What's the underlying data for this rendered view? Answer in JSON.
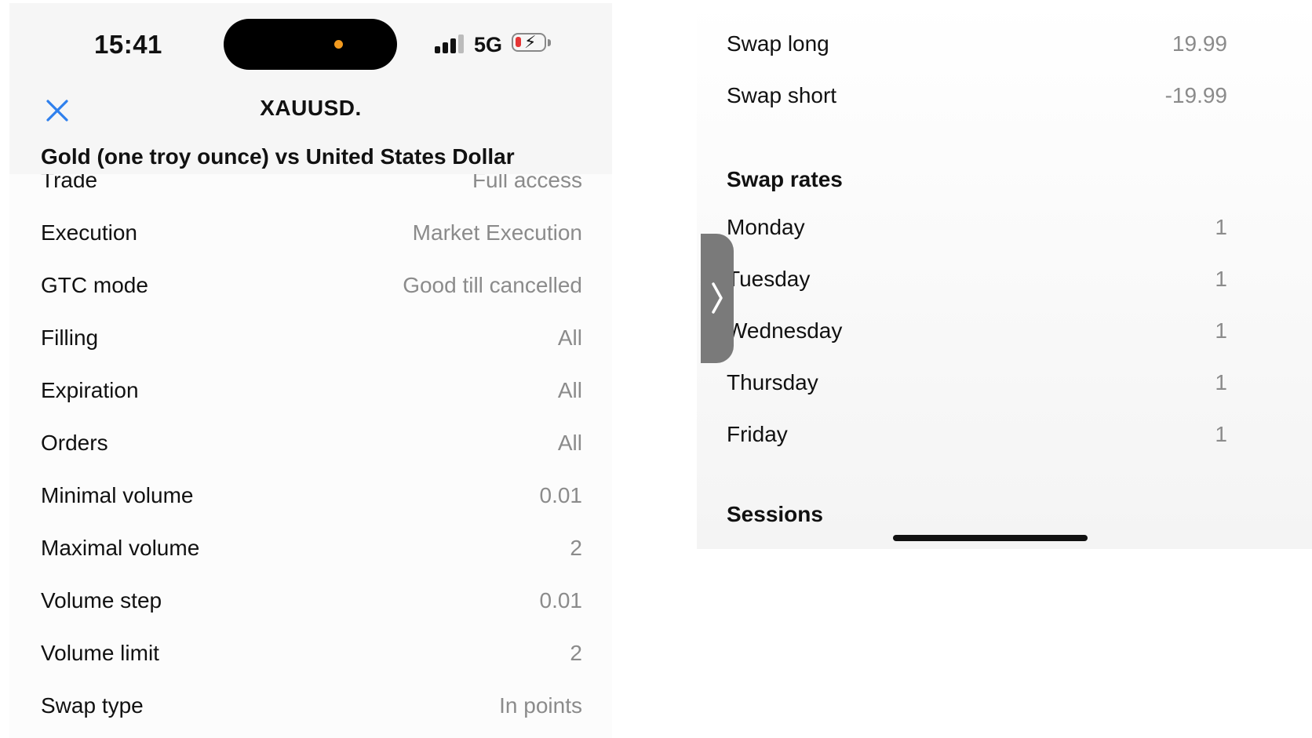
{
  "status_bar": {
    "time": "15:41",
    "network": "5G",
    "battery_level": 0.2,
    "battery_color": "#e53535",
    "charging": true
  },
  "nav": {
    "title": "XAUUSD.",
    "close_icon": "close-icon",
    "accent": "#2f80ed"
  },
  "symbol": {
    "description": "Gold (one troy ounce) vs United States Dollar"
  },
  "left_rows": [
    {
      "label": "Trade",
      "value": "Full access"
    },
    {
      "label": "Execution",
      "value": "Market Execution"
    },
    {
      "label": "GTC mode",
      "value": "Good till cancelled"
    },
    {
      "label": "Filling",
      "value": "All"
    },
    {
      "label": "Expiration",
      "value": "All"
    },
    {
      "label": "Orders",
      "value": "All"
    },
    {
      "label": "Minimal volume",
      "value": "0.01"
    },
    {
      "label": "Maximal volume",
      "value": "2"
    },
    {
      "label": "Volume step",
      "value": "0.01"
    },
    {
      "label": "Volume limit",
      "value": "2"
    },
    {
      "label": "Swap type",
      "value": "In points"
    }
  ],
  "swap": {
    "long_label": "Swap long",
    "long_value": "19.99",
    "short_label": "Swap short",
    "short_value": "-19.99"
  },
  "swap_rates": {
    "title": "Swap rates",
    "days": [
      {
        "label": "Monday",
        "value": "1"
      },
      {
        "label": "Tuesday",
        "value": "1"
      },
      {
        "label": "Wednesday",
        "value": "1"
      },
      {
        "label": "Thursday",
        "value": "1"
      },
      {
        "label": "Friday",
        "value": "1"
      }
    ]
  },
  "sessions": {
    "title": "Sessions"
  },
  "side_tab_icon": "chevron-right-icon"
}
